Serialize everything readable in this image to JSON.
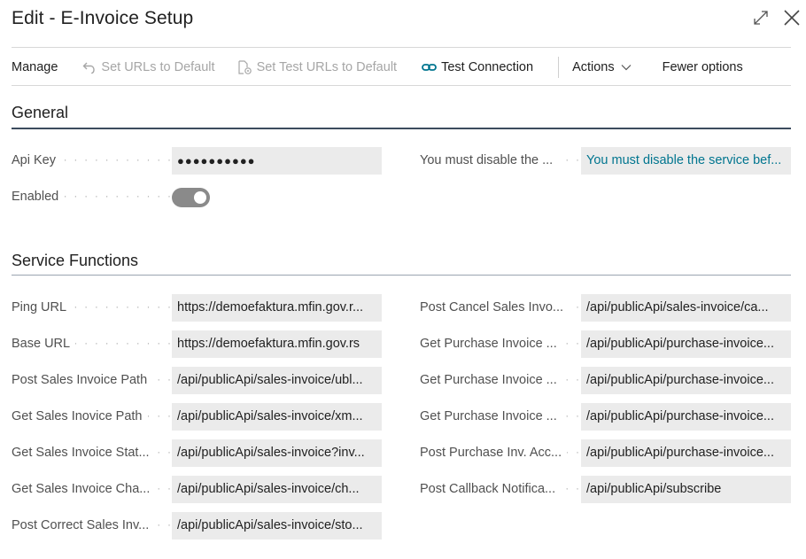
{
  "window": {
    "title": "Edit - E-Invoice Setup",
    "expand_icon": "expand-arrows-icon",
    "close_icon": "close-icon"
  },
  "actionbar": {
    "manage": "Manage",
    "set_urls_default": "Set URLs to Default",
    "set_test_urls_default": "Set Test URLs to Default",
    "test_connection": "Test Connection",
    "actions": "Actions",
    "fewer_options": "Fewer options"
  },
  "general": {
    "title": "General",
    "api_key_label": "Api Key",
    "api_key_value": "●●●●●●●●●●",
    "enabled_label": "Enabled",
    "enabled": true,
    "notice_label": "You must disable the ...",
    "notice_value": "You must disable the service bef..."
  },
  "service_functions": {
    "title": "Service Functions",
    "left": [
      {
        "label": "Ping URL",
        "value": "https://demoefaktura.mfin.gov.r..."
      },
      {
        "label": "Base URL",
        "value": "https://demoefaktura.mfin.gov.rs"
      },
      {
        "label": "Post Sales Invoice Path",
        "value": "/api/publicApi/sales-invoice/ubl..."
      },
      {
        "label": "Get Sales Inovice Path",
        "value": "/api/publicApi/sales-invoice/xm..."
      },
      {
        "label": "Get Sales Invoice Stat...",
        "value": "/api/publicApi/sales-invoice?inv..."
      },
      {
        "label": "Get Sales Invoice Cha...",
        "value": "/api/publicApi/sales-invoice/ch..."
      },
      {
        "label": "Post Correct Sales Inv...",
        "value": "/api/publicApi/sales-invoice/sto..."
      }
    ],
    "right": [
      {
        "label": "Post Cancel Sales Invo...",
        "value": "/api/publicApi/sales-invoice/ca..."
      },
      {
        "label": "Get Purchase Invoice ...",
        "value": "/api/publicApi/purchase-invoice..."
      },
      {
        "label": "Get Purchase Invoice ...",
        "value": "/api/publicApi/purchase-invoice..."
      },
      {
        "label": "Get Purchase Invoice ...",
        "value": "/api/publicApi/purchase-invoice..."
      },
      {
        "label": "Post Purchase Inv. Acc...",
        "value": "/api/publicApi/purchase-invoice..."
      },
      {
        "label": "Post Callback Notifica...",
        "value": "/api/publicApi/subscribe"
      }
    ]
  },
  "colors": {
    "accent_link": "#00758f",
    "section_rule": "#3c4b5e",
    "field_bg": "#ebebeb",
    "toggle_bg": "#8a8a8a"
  }
}
